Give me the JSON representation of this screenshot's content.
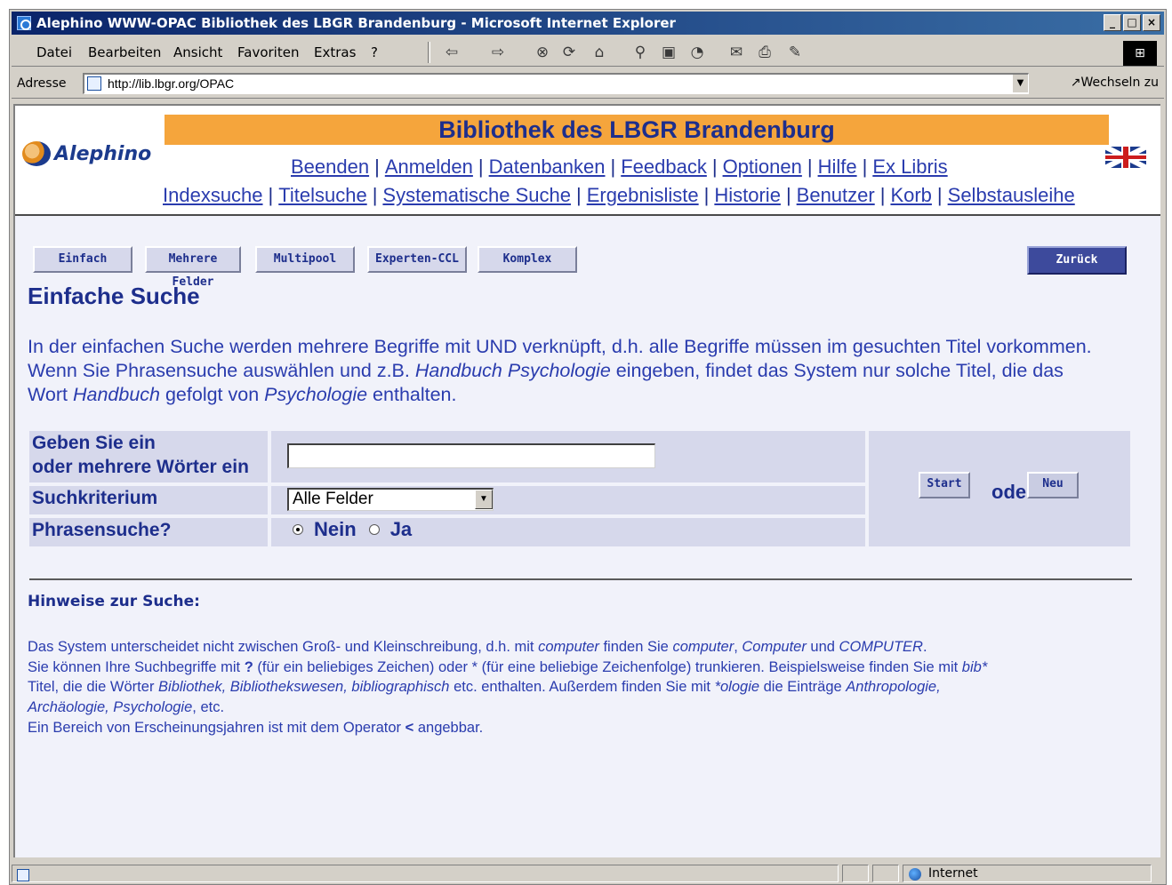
{
  "window": {
    "title": "Alephino WWW-OPAC Bibliothek des LBGR Brandenburg - Microsoft Internet Explorer",
    "controls": [
      "_",
      "□",
      "×"
    ]
  },
  "menu": [
    "Datei",
    "Bearbeiten",
    "Ansicht",
    "Favoriten",
    "Extras",
    "?"
  ],
  "toolbar_icons": [
    "back-arrow-icon",
    "forward-arrow-icon",
    "stop-icon",
    "refresh-icon",
    "home-icon",
    "search-icon",
    "favorites-icon",
    "history-icon",
    "mail-icon",
    "print-icon",
    "edit-icon"
  ],
  "address": {
    "label": "Adresse",
    "url": "http://lib.lbgr.org/OPAC",
    "go_label": "Wechseln zu"
  },
  "header": {
    "logo_text": "Alephino",
    "banner": "Bibliothek des LBGR Brandenburg",
    "nav1": [
      "Beenden",
      "Anmelden",
      "Datenbanken",
      "Feedback",
      "Optionen",
      "Hilfe",
      "Ex Libris"
    ],
    "nav2": [
      "Indexsuche",
      "Titelsuche",
      "Systematische Suche",
      "Ergebnisliste",
      "Historie",
      "Benutzer",
      "Korb",
      "Selbstausleihe"
    ],
    "separator": "|"
  },
  "search_tabs": [
    "Einfach",
    "Mehrere Felder",
    "Multipool",
    "Experten-CCL",
    "Komplex"
  ],
  "back_button": "Zurück",
  "page_title": "Einfache Suche",
  "intro": {
    "line1": "In der einfachen Suche werden mehrere Begriffe mit UND verknüpft, d.h. alle Begriffe müssen im gesuchten Titel vorkommen.",
    "line2_a": "Wenn Sie Phrasensuche auswählen und z.B. ",
    "line2_i": "Handbuch Psychologie",
    "line2_b": " eingeben, findet das System nur solche Titel, die das",
    "line3_a": "Wort ",
    "line3_i1": "Handbuch",
    "line3_b": " gefolgt von ",
    "line3_i2": "Psychologie",
    "line3_c": " enthalten."
  },
  "form": {
    "term_label_1": "Geben Sie ein",
    "term_label_2": "oder mehrere Wörter ein",
    "term_value": "",
    "criterion_label": "Suchkriterium",
    "criterion_value": "Alle Felder",
    "phrase_label": "Phrasensuche?",
    "phrase_no": "Nein",
    "phrase_yes": "Ja",
    "phrase_selected": "Nein",
    "start_button": "Start",
    "or_text": "oder",
    "new_button": "Neu"
  },
  "hints": {
    "title": "Hinweise zur Suche:",
    "l1_a": "Das System unterscheidet nicht zwischen Groß- und Kleinschreibung, d.h. mit ",
    "l1_i1": "computer",
    "l1_b": " finden Sie ",
    "l1_i2": "computer",
    "l1_c": ", ",
    "l1_i3": "Computer",
    "l1_d": " und ",
    "l1_i4": "COMPUTER",
    "l1_e": ".",
    "l2_a": "Sie können Ihre Suchbegriffe mit ",
    "l2_q": "?",
    "l2_b": " (für ein beliebiges Zeichen) oder * (für eine beliebige Zeichenfolge) trunkieren. Beispielsweise finden Sie mit ",
    "l2_i": "bib*",
    "l3_a": "Titel, die die Wörter ",
    "l3_i": "Bibliothek, Bibliothekswesen, bibliographisch",
    "l3_b": " etc. enthalten. Außerdem finden Sie mit ",
    "l3_i2": "*ologie",
    "l3_c": " die Einträge ",
    "l3_i3": "Anthropologie,",
    "l4_i": "Archäologie, Psychologie",
    "l4_b": ", etc.",
    "l5_a": "Ein Bereich von Erscheinungsjahren ist mit dem Operator ",
    "l5_op": "<",
    "l5_b": " angebbar."
  },
  "status": {
    "zone": "Internet"
  },
  "colors": {
    "title_bar": "#0a246a",
    "banner": "#f5a53c",
    "link": "#2a3cae",
    "heading": "#1d2e8c",
    "form_bg": "#d6d8eb",
    "back_button": "#3d4a9c"
  }
}
